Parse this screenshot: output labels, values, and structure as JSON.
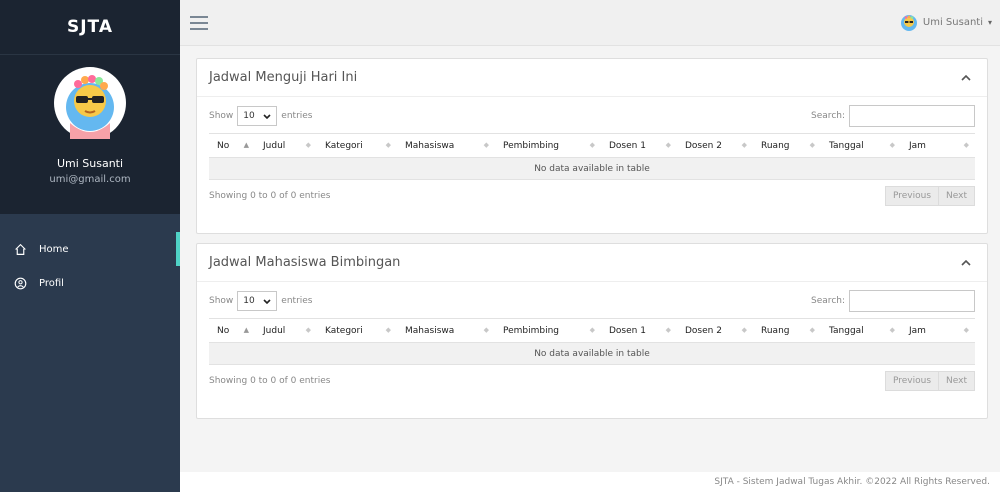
{
  "app": {
    "brand": "SJTA",
    "footer": "SJTA - Sistem Jadwal Tugas Akhir. ©2022 All Rights Reserved."
  },
  "profile": {
    "name": "Umi Susanti",
    "email": "umi@gmail.com"
  },
  "sidebar": {
    "items": [
      {
        "label": "Home",
        "icon": "home-icon",
        "active": true
      },
      {
        "label": "Profil",
        "icon": "user-circle-icon",
        "active": false
      }
    ]
  },
  "topbar": {
    "user_name": "Umi Susanti",
    "caret": "▾"
  },
  "panels": [
    {
      "title": "Jadwal Menguji Hari Ini",
      "show_label": "Show",
      "entries_value": "10",
      "entries_label": "entries",
      "search_label": "Search:",
      "search_value": "",
      "columns": [
        "No",
        "Judul",
        "Kategori",
        "Mahasiswa",
        "Pembimbing",
        "Dosen 1",
        "Dosen 2",
        "Ruang",
        "Tanggal",
        "Jam"
      ],
      "empty_text": "No data available in table",
      "info": "Showing 0 to 0 of 0 entries",
      "prev_label": "Previous",
      "next_label": "Next"
    },
    {
      "title": "Jadwal Mahasiswa Bimbingan",
      "show_label": "Show",
      "entries_value": "10",
      "entries_label": "entries",
      "search_label": "Search:",
      "search_value": "",
      "columns": [
        "No",
        "Judul",
        "Kategori",
        "Mahasiswa",
        "Pembimbing",
        "Dosen 1",
        "Dosen 2",
        "Ruang",
        "Tanggal",
        "Jam"
      ],
      "empty_text": "No data available in table",
      "info": "Showing 0 to 0 of 0 entries",
      "prev_label": "Previous",
      "next_label": "Next"
    }
  ],
  "colors": {
    "sidebar_bg": "#2b3a4e",
    "brand_bg": "#1b2431",
    "active_indicator": "#4fd1c5"
  }
}
